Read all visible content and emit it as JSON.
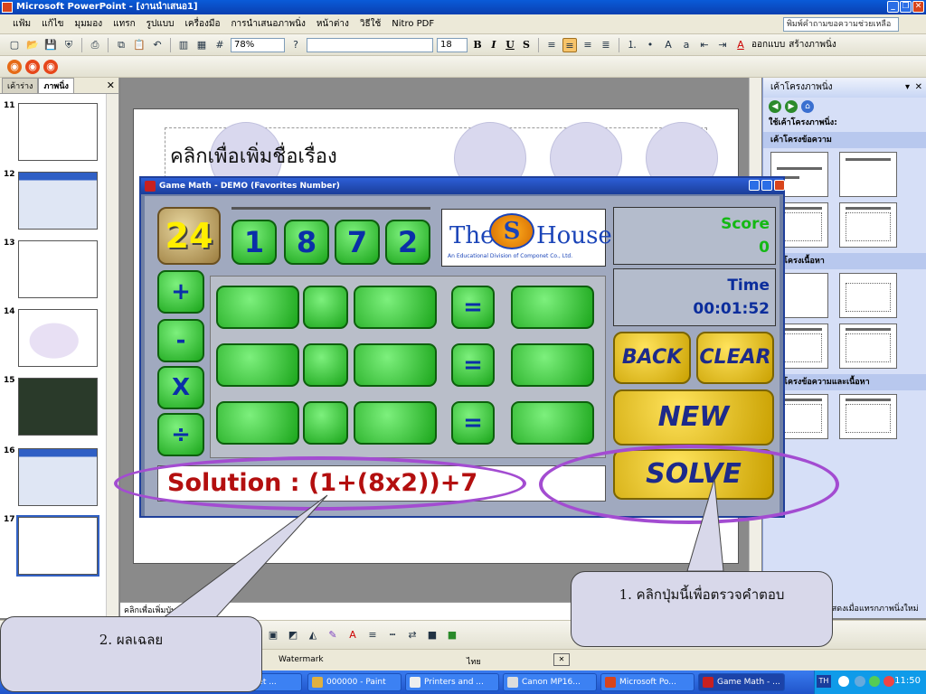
{
  "window": {
    "title": "Microsoft PowerPoint - [งานนำเสนอ1]"
  },
  "menu": {
    "items": [
      "แฟ้ม",
      "แก้ไข",
      "มุมมอง",
      "แทรก",
      "รูปแบบ",
      "เครื่องมือ",
      "การนำเสนอภาพนิ่ง",
      "หน้าต่าง",
      "วิธีใช้",
      "Nitro PDF"
    ],
    "help_placeholder": "พิมพ์คำถามขอความช่วยเหลือ"
  },
  "toolbar": {
    "zoom": "78%",
    "font_size": "18",
    "design_label": "ออกแบบ",
    "new_slide_label": "สร้างภาพนิ่ง"
  },
  "slides_pane": {
    "tabs": [
      "เค้าร่าง",
      "ภาพนิ่ง"
    ],
    "slide_numbers": [
      "11",
      "12",
      "13",
      "14",
      "15",
      "16",
      "17"
    ]
  },
  "slide": {
    "title_placeholder": "คลิกเพื่อเพิ่มชื่อเรื่อง",
    "notes_placeholder": "คลิกเพื่อเพิ่มบันทึกย่อ"
  },
  "task_pane": {
    "title": "เค้าโครงภาพนิ่ง",
    "apply_label": "ใช้เค้าโครงภาพนิ่ง:",
    "groups": [
      "เค้าโครงข้อความ",
      "เค้าโครงเนื้อหา",
      "เค้าโครงข้อความและเนื้อหา"
    ],
    "footer": "แสดงเมื่อแทรกภาพนิ่งใหม่"
  },
  "status": {
    "watermark": "Watermark",
    "language": "ไทย"
  },
  "taskbar": {
    "items": [
      "...net ...",
      "000000 - Paint",
      "Printers and ...",
      "Canon MP16...",
      "Microsoft Po...",
      "Game Math - ..."
    ],
    "lang": "TH",
    "clock": "11:50"
  },
  "game": {
    "window_title": "Game Math - DEMO (Favorites Number)",
    "target": "24",
    "numbers": [
      "1",
      "8",
      "7",
      "2"
    ],
    "logo": {
      "the": "The",
      "s": "S",
      "house": "House",
      "tagline": "An Educational Division of Componet Co., Ltd."
    },
    "score_label": "Score",
    "score_value": "0",
    "time_label": "Time",
    "time_value": "00:01:52",
    "operators": [
      "+",
      "-",
      "X",
      "÷"
    ],
    "equals": "=",
    "back_label": "BACK",
    "clear_label": "CLEAR",
    "new_label": "NEW",
    "solve_label": "SOLVE",
    "solution": "Solution : (1+(8x2))+7"
  },
  "callouts": {
    "check_answer": "1. คลิกปุ่มนี้เพื่อตรวจคำตอบ",
    "solution": "2. ผลเฉลย"
  },
  "colors": {
    "highlight": "#a34cd1",
    "button_green": "#1aa51a",
    "button_gold": "#c9a000",
    "solution_red": "#b30f0f"
  }
}
